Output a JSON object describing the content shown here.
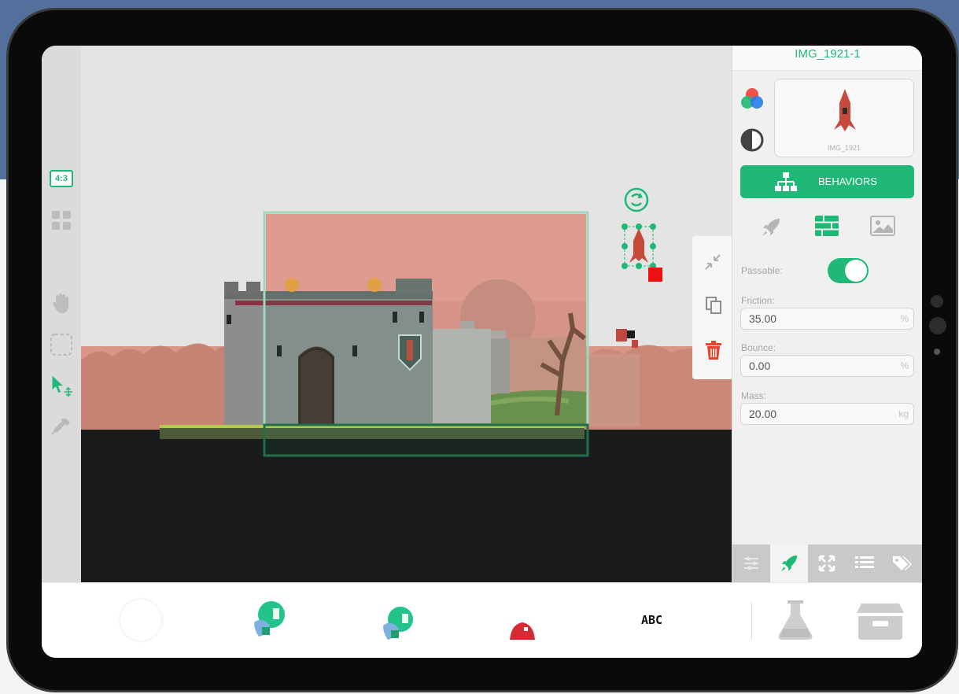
{
  "object_name": "IMG_1921-1",
  "sprite_thumbnail_label": "IMG_1921",
  "left_toolbar": {
    "aspect_ratio": "4:3"
  },
  "behaviors_button": "BEHAVIORS",
  "physics": {
    "passable_label": "Passable:",
    "passable_on": true,
    "friction_label": "Friction:",
    "friction_value": "35.00",
    "friction_unit": "%",
    "bounce_label": "Bounce:",
    "bounce_value": "0.00",
    "bounce_unit": "%",
    "mass_label": "Mass:",
    "mass_value": "20.00",
    "mass_unit": "kg"
  },
  "bottom_bar": {
    "text_object": "ABC"
  },
  "colors": {
    "accent": "#1fb876",
    "delete": "#e5452d",
    "canvas_ground": "#1a1b1c",
    "sky": "#e8928c"
  },
  "icons": [
    "aspect-ratio-icon",
    "grid-icon",
    "hand-icon",
    "marquee-icon",
    "select-move-icon",
    "eyedropper-icon",
    "rotate-icon",
    "shrink-icon",
    "duplicate-icon",
    "trash-icon",
    "color-icon",
    "contrast-icon",
    "hierarchy-icon",
    "rocket-icon",
    "bricks-icon",
    "image-icon",
    "sliders-icon",
    "expand-icon",
    "list-icon",
    "tags-icon",
    "flask-icon",
    "archive-box-icon"
  ]
}
